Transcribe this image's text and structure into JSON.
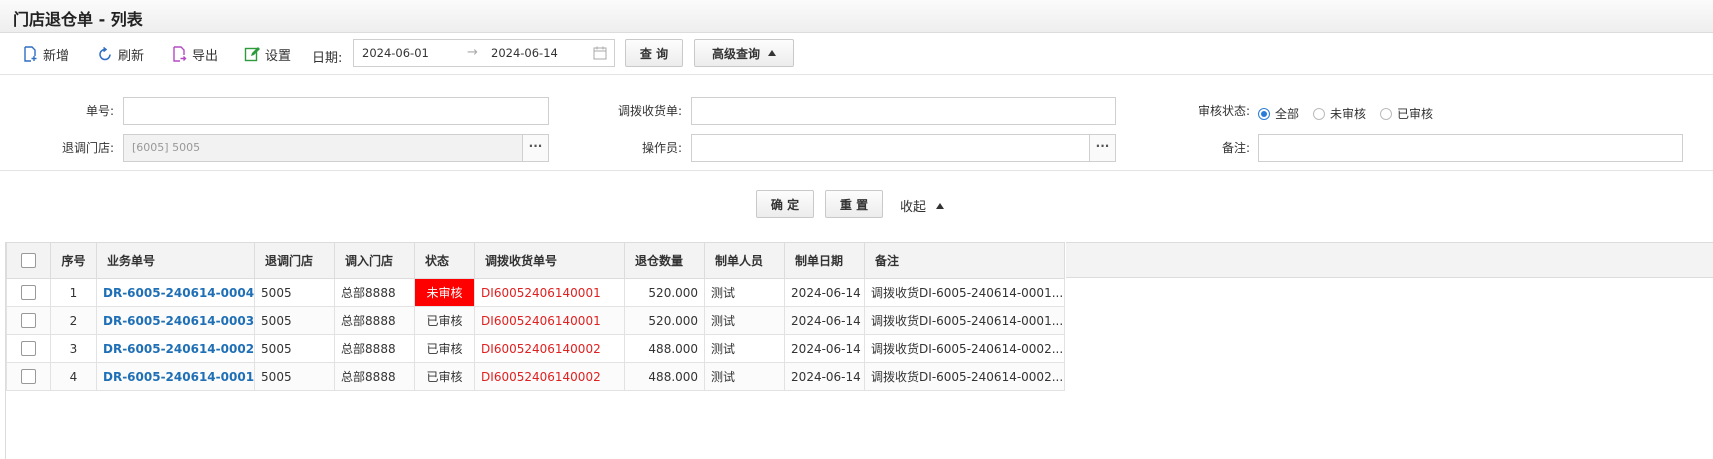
{
  "page": {
    "title": "门店退仓单 - 列表"
  },
  "toolbar": {
    "new_label": "新增",
    "refresh_label": "刷新",
    "export_label": "导出",
    "settings_label": "设置",
    "date_label": "日期:",
    "date_from": "2024-06-01",
    "date_arrow": "→",
    "date_to": "2024-06-14",
    "query_label": "查 询",
    "advanced_label": "高级查询"
  },
  "filter": {
    "doc_no_label": "单号:",
    "doc_no_value": "",
    "transfer_receipt_label": "调拨收货单:",
    "transfer_receipt_value": "",
    "audit_status_label": "审核状态:",
    "audit_options": [
      "全部",
      "未审核",
      "已审核"
    ],
    "audit_selected": "全部",
    "return_store_label": "退调门店:",
    "return_store_value": "[6005] 5005",
    "operator_label": "操作员:",
    "operator_value": "",
    "remark_label": "备注:",
    "remark_value": "",
    "dots": "···",
    "confirm_label": "确 定",
    "reset_label": "重 置",
    "collapse_label": "收起"
  },
  "table": {
    "columns": [
      "序号",
      "业务单号",
      "退调门店",
      "调入门店",
      "状态",
      "调拨收货单号",
      "退仓数量",
      "制单人员",
      "制单日期",
      "备注"
    ],
    "rows": [
      {
        "seq": "1",
        "doc_no": "DR-6005-240614-0004",
        "out_store": "5005",
        "in_store": "总部8888",
        "status": "未审核",
        "receipt_no": "DI60052406140001",
        "qty": "520.000",
        "creator": "测试",
        "date": "2024-06-14",
        "remark": "调拨收货DI-6005-240614-0001..."
      },
      {
        "seq": "2",
        "doc_no": "DR-6005-240614-0003",
        "out_store": "5005",
        "in_store": "总部8888",
        "status": "已审核",
        "receipt_no": "DI60052406140001",
        "qty": "520.000",
        "creator": "测试",
        "date": "2024-06-14",
        "remark": "调拨收货DI-6005-240614-0001..."
      },
      {
        "seq": "3",
        "doc_no": "DR-6005-240614-0002",
        "out_store": "5005",
        "in_store": "总部8888",
        "status": "已审核",
        "receipt_no": "DI60052406140002",
        "qty": "488.000",
        "creator": "测试",
        "date": "2024-06-14",
        "remark": "调拨收货DI-6005-240614-0002..."
      },
      {
        "seq": "4",
        "doc_no": "DR-6005-240614-0001",
        "out_store": "5005",
        "in_store": "总部8888",
        "status": "已审核",
        "receipt_no": "DI60052406140002",
        "qty": "488.000",
        "creator": "测试",
        "date": "2024-06-14",
        "remark": "调拨收货DI-6005-240614-0002..."
      }
    ]
  },
  "colors": {
    "link": "#1e6fb6",
    "red": "#e02020",
    "badge_bg": "#ff0000",
    "radio": "#2b7bd8"
  },
  "icons": {
    "new": "file-plus-icon",
    "refresh": "refresh-icon",
    "export": "export-icon",
    "settings": "edit-icon",
    "calendar": "calendar-icon"
  }
}
